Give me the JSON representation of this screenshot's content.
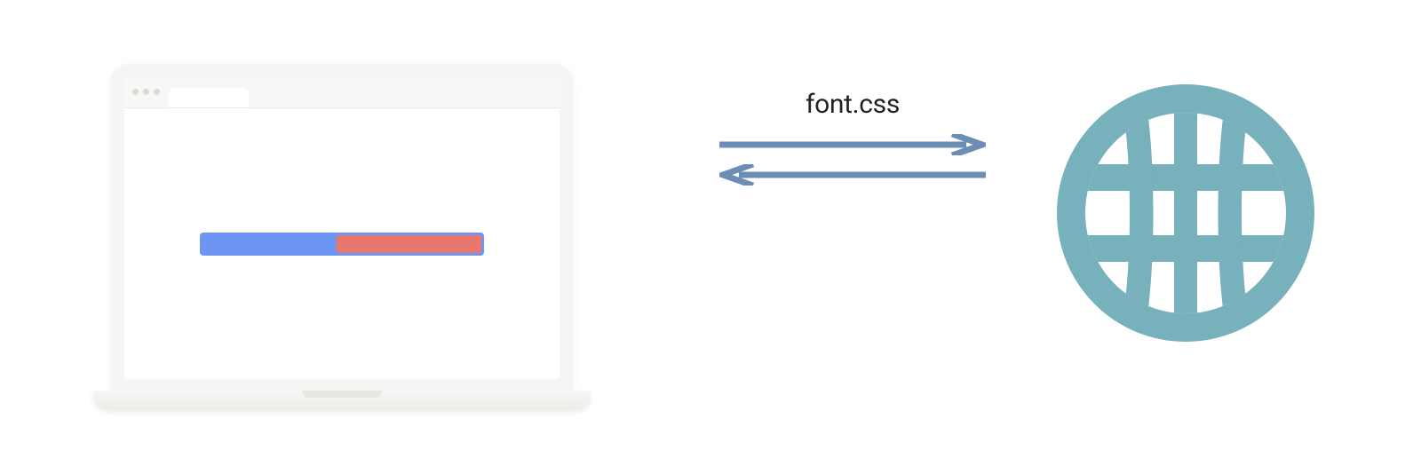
{
  "diagram": {
    "exchange_label": "font.css",
    "colors": {
      "arrow": "#6C8EB5",
      "globe": "#77B1BB",
      "bar_bg": "#6E94F4",
      "bar_fill": "#E8776E",
      "laptop_bezel": "#F5F5F3"
    },
    "elements": {
      "laptop": "laptop-with-browser-progress-bar",
      "arrows": "bidirectional-request-response",
      "globe": "internet-globe"
    }
  }
}
